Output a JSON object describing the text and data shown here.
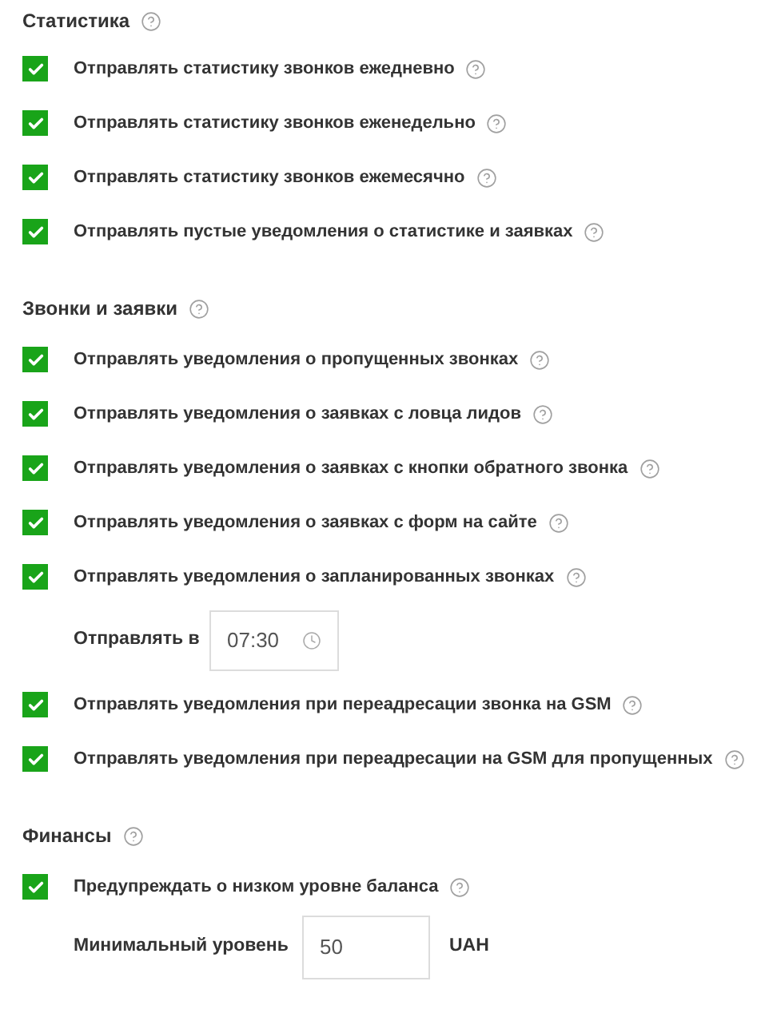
{
  "sections": [
    {
      "title": "Статистика",
      "items": [
        {
          "kind": "checkbox",
          "label": "Отправлять статистику звонков ежедневно",
          "checked": true
        },
        {
          "kind": "checkbox",
          "label": "Отправлять статистику звонков еженедельно",
          "checked": true
        },
        {
          "kind": "checkbox",
          "label": "Отправлять статистику звонков ежемесячно",
          "checked": true
        },
        {
          "kind": "checkbox",
          "label": "Отправлять пустые уведомления о статистике и заявках",
          "checked": true
        }
      ]
    },
    {
      "title": "Звонки и заявки",
      "items": [
        {
          "kind": "checkbox",
          "label": "Отправлять уведомления о пропущенных звонках",
          "checked": true
        },
        {
          "kind": "checkbox",
          "label": "Отправлять уведомления о заявках с ловца лидов",
          "checked": true
        },
        {
          "kind": "checkbox",
          "label": "Отправлять уведомления о заявках с кнопки обратного звонка",
          "checked": true
        },
        {
          "kind": "checkbox",
          "label": "Отправлять уведомления о заявках с форм на сайте",
          "checked": true
        },
        {
          "kind": "checkbox",
          "label": "Отправлять уведомления о запланированных звонках",
          "checked": true
        },
        {
          "kind": "time",
          "label": "Отправлять в",
          "value": "07:30"
        },
        {
          "kind": "checkbox",
          "label": "Отправлять уведомления при переадресации звонка на GSM",
          "checked": true
        },
        {
          "kind": "checkbox",
          "label": "Отправлять уведомления при переадресации на GSM для пропущенных",
          "checked": true
        }
      ]
    },
    {
      "title": "Финансы",
      "items": [
        {
          "kind": "checkbox",
          "label": "Предупреждать о низком уровне баланса",
          "checked": true
        },
        {
          "kind": "amount",
          "label": "Минимальный уровень",
          "value": "50",
          "unit": "UAH"
        }
      ]
    }
  ]
}
